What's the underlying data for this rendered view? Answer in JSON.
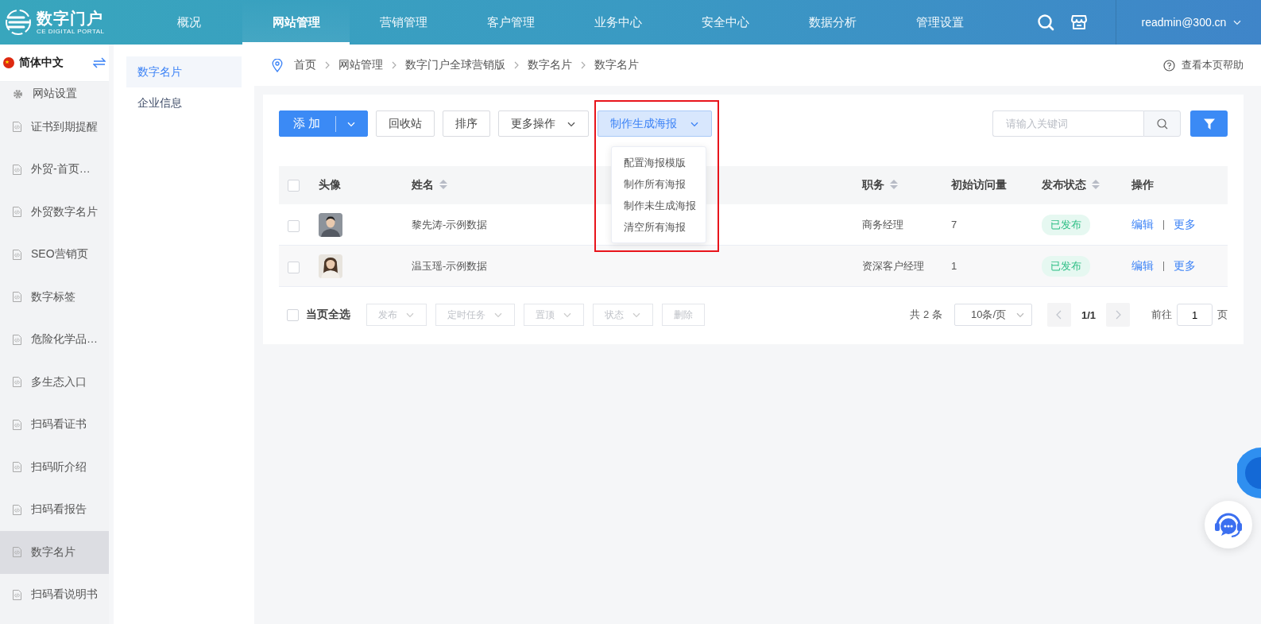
{
  "header": {
    "logo": {
      "title": "数字门户",
      "subtitle": "CE DIGITAL PORTAL"
    },
    "nav": [
      {
        "label": "概况",
        "selected": false
      },
      {
        "label": "网站管理",
        "selected": true
      },
      {
        "label": "营销管理",
        "selected": false
      },
      {
        "label": "客户管理",
        "selected": false
      },
      {
        "label": "业务中心",
        "selected": false
      },
      {
        "label": "安全中心",
        "selected": false
      },
      {
        "label": "数据分析",
        "selected": false
      },
      {
        "label": "管理设置",
        "selected": false
      }
    ],
    "user": "readmin@300.cn"
  },
  "sidebar": {
    "language": "简体中文",
    "items": [
      {
        "label": "网站设置",
        "kind": "gear",
        "selected": false
      },
      {
        "label": "证书到期提醒",
        "kind": "page",
        "selected": false
      },
      {
        "label": "外贸-首页…",
        "kind": "page",
        "selected": false
      },
      {
        "label": "外贸数字名片",
        "kind": "page",
        "selected": false
      },
      {
        "label": "SEO营销页",
        "kind": "page",
        "selected": false
      },
      {
        "label": "数字标签",
        "kind": "page",
        "selected": false
      },
      {
        "label": "危险化学品…",
        "kind": "page",
        "selected": false
      },
      {
        "label": "多生态入口",
        "kind": "page",
        "selected": false
      },
      {
        "label": "扫码看证书",
        "kind": "page",
        "selected": false
      },
      {
        "label": "扫码听介绍",
        "kind": "page",
        "selected": false
      },
      {
        "label": "扫码看报告",
        "kind": "page",
        "selected": false
      },
      {
        "label": "数字名片",
        "kind": "page",
        "selected": true
      },
      {
        "label": "扫码看说明书",
        "kind": "page",
        "selected": false
      }
    ]
  },
  "subnav": [
    {
      "label": "数字名片",
      "selected": true
    },
    {
      "label": "企业信息",
      "selected": false
    }
  ],
  "breadcrumb": [
    "首页",
    "网站管理",
    "数字门户全球营销版",
    "数字名片",
    "数字名片"
  ],
  "help": "查看本页帮助",
  "toolbar": {
    "add": "添 加",
    "buttons": [
      {
        "label": "回收站",
        "dropdown": false
      },
      {
        "label": "排序",
        "dropdown": false
      },
      {
        "label": "更多操作",
        "dropdown": true
      }
    ],
    "poster": {
      "label": "制作生成海报",
      "expanded": true,
      "menu": [
        "配置海报模版",
        "制作所有海报",
        "制作未生成海报",
        "清空所有海报"
      ]
    },
    "search": {
      "placeholder": "请输入关键词"
    }
  },
  "table": {
    "header_checked": false,
    "columns": [
      {
        "label": "头像",
        "sortable": false
      },
      {
        "label": "姓名",
        "sortable": true
      },
      {
        "label": "职务",
        "sortable": true
      },
      {
        "label": "初始访问量",
        "sortable": false
      },
      {
        "label": "发布状态",
        "sortable": true
      },
      {
        "label": "操作",
        "sortable": false
      }
    ],
    "rows": [
      {
        "checked": false,
        "avatar": {
          "kind": "picture"
        },
        "name": "黎先涛-示例数据",
        "position": "商务经理",
        "visits": "7",
        "status": "已发布",
        "actions": [
          "编辑",
          "更多"
        ]
      },
      {
        "checked": false,
        "avatar": {
          "kind": "picture"
        },
        "name": "温玉瑶-示例数据",
        "position": "资深客户经理",
        "visits": "1",
        "status": "已发布",
        "actions": [
          "编辑",
          "更多"
        ]
      }
    ]
  },
  "bulk": {
    "select_all": {
      "label": "当页全选",
      "checked": false
    },
    "actions": [
      {
        "label": "发布",
        "dropdown": true,
        "disabled": true
      },
      {
        "label": "定时任务",
        "dropdown": true,
        "disabled": true
      },
      {
        "label": "置顶",
        "dropdown": true,
        "disabled": true
      },
      {
        "label": "状态",
        "dropdown": true,
        "disabled": true
      },
      {
        "label": "删除",
        "dropdown": false,
        "disabled": true
      }
    ]
  },
  "pagination": {
    "total": "共 2 条",
    "page_size": "10条/页",
    "page": "1/1",
    "goto_label": "前往",
    "goto_value": "1",
    "page_unit": "页"
  }
}
